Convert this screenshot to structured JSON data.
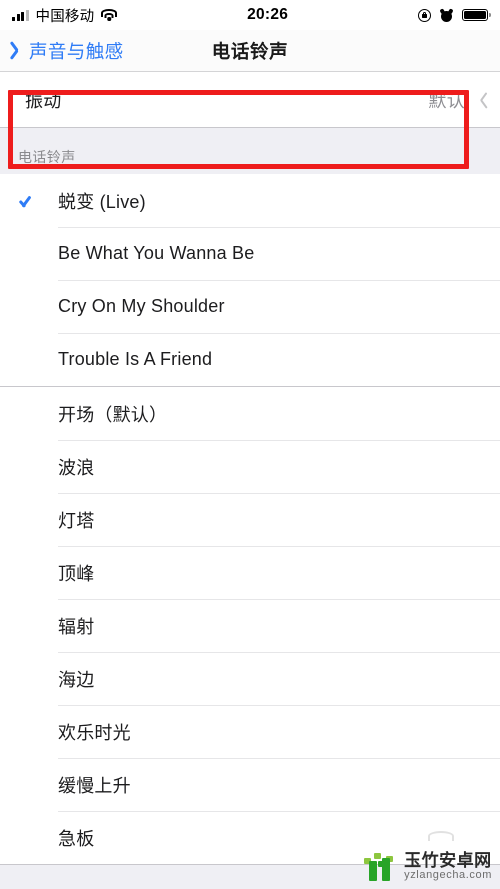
{
  "status_bar": {
    "carrier": "中国移动",
    "time": "20:26",
    "icons": {
      "signal": "signal-bars-icon",
      "wifi": "wifi-icon",
      "rotation_lock": "rotation-lock-icon",
      "alarm": "alarm-clock-icon",
      "battery": "battery-full-icon"
    }
  },
  "nav": {
    "back_label": "声音与触感",
    "title": "电话铃声"
  },
  "vibration_row": {
    "label": "振动",
    "value": "默认",
    "chevron": "chevron-right-icon"
  },
  "section_header": "电话铃声",
  "ringtone_groups": [
    {
      "name": "custom",
      "items": [
        {
          "label": "蜕变 (Live)",
          "selected": true
        },
        {
          "label": "Be What You Wanna Be",
          "selected": false
        },
        {
          "label": "Cry On My Shoulder",
          "selected": false
        },
        {
          "label": "Trouble Is A Friend",
          "selected": false
        }
      ]
    },
    {
      "name": "system",
      "items": [
        {
          "label": "开场（默认）",
          "selected": false
        },
        {
          "label": "波浪",
          "selected": false
        },
        {
          "label": "灯塔",
          "selected": false
        },
        {
          "label": "顶峰",
          "selected": false
        },
        {
          "label": "辐射",
          "selected": false
        },
        {
          "label": "海边",
          "selected": false
        },
        {
          "label": "欢乐时光",
          "selected": false
        },
        {
          "label": "缓慢上升",
          "selected": false
        },
        {
          "label": "急板",
          "selected": false
        }
      ]
    }
  ],
  "annotation": {
    "color": "#ee1c1c",
    "target": "振动"
  },
  "watermark": {
    "name_cn": "玉竹安卓网",
    "url": "yzlangecha.com"
  },
  "colors": {
    "accent_blue": "#2f7cf6",
    "page_bg": "#efeff4",
    "cell_bg": "#ffffff",
    "secondary_text": "#8e8e93",
    "annotation_red": "#ee1c1c"
  }
}
